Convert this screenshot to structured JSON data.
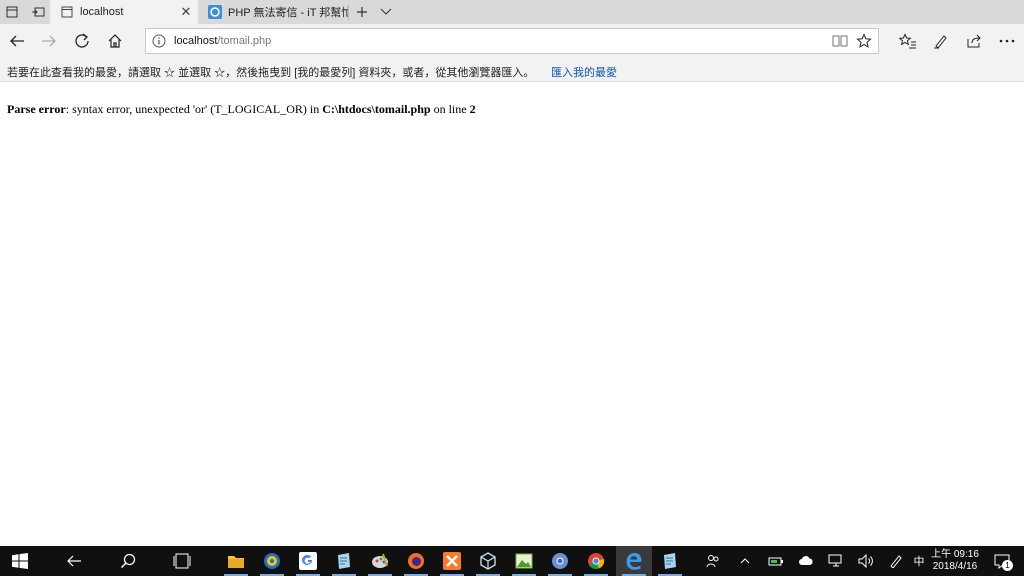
{
  "tabs": [
    {
      "title": "localhost",
      "active": true
    },
    {
      "title": "PHP 無法寄信 - iT 邦幫忙::",
      "active": false
    }
  ],
  "address_bar": {
    "host": "localhost",
    "path": "/tomail.php"
  },
  "favorites_bar": {
    "message": "若要在此查看我的最愛，請選取  ☆  並選取 ☆，然後拖曳到 [我的最愛列] 資料夾，或者，從其他瀏覽器匯入。",
    "import_link": "匯入我的最愛"
  },
  "page": {
    "error_label": "Parse error",
    "error_message": ": syntax error, unexpected 'or' (T_LOGICAL_OR) in ",
    "error_file": "C:\\htdocs\\tomail.php",
    "error_on_line": " on line ",
    "error_line": "2"
  },
  "taskbar": {
    "ime": "中",
    "clock_time": "上午 09:16",
    "clock_date": "2018/4/16",
    "notification_count": "1"
  },
  "colors": {
    "tab_strip": "#d9d9d9",
    "toolbar": "#f2f2f2",
    "link": "#0a56b0",
    "taskbar": "#101010"
  }
}
